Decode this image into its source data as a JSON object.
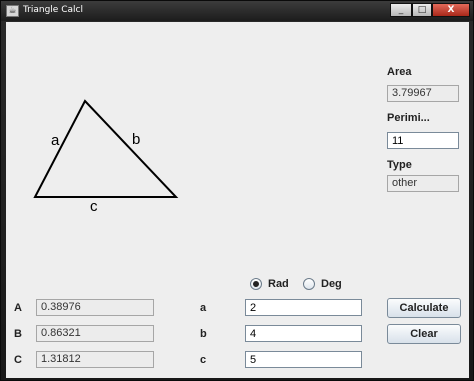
{
  "window": {
    "title": "Triangle Calcl",
    "minimize": "_",
    "maximize": "□",
    "close": "X"
  },
  "diagram": {
    "side_a": "a",
    "side_b": "b",
    "side_c": "c"
  },
  "results": {
    "area_label": "Area",
    "area_value": "3.79967",
    "perimeter_label": "Perimi...",
    "perimeter_value": "11",
    "type_label": "Type",
    "type_value": "other"
  },
  "units": {
    "rad_label": "Rad",
    "deg_label": "Deg",
    "selected": "Rad"
  },
  "angles": {
    "A_label": "A",
    "A_value": "0.38976",
    "B_label": "B",
    "B_value": "0.86321",
    "C_label": "C",
    "C_value": "1.31812"
  },
  "sides": {
    "a_label": "a",
    "a_value": "2",
    "b_label": "b",
    "b_value": "4",
    "c_label": "c",
    "c_value": "5"
  },
  "buttons": {
    "calculate": "Calculate",
    "clear": "Clear"
  }
}
